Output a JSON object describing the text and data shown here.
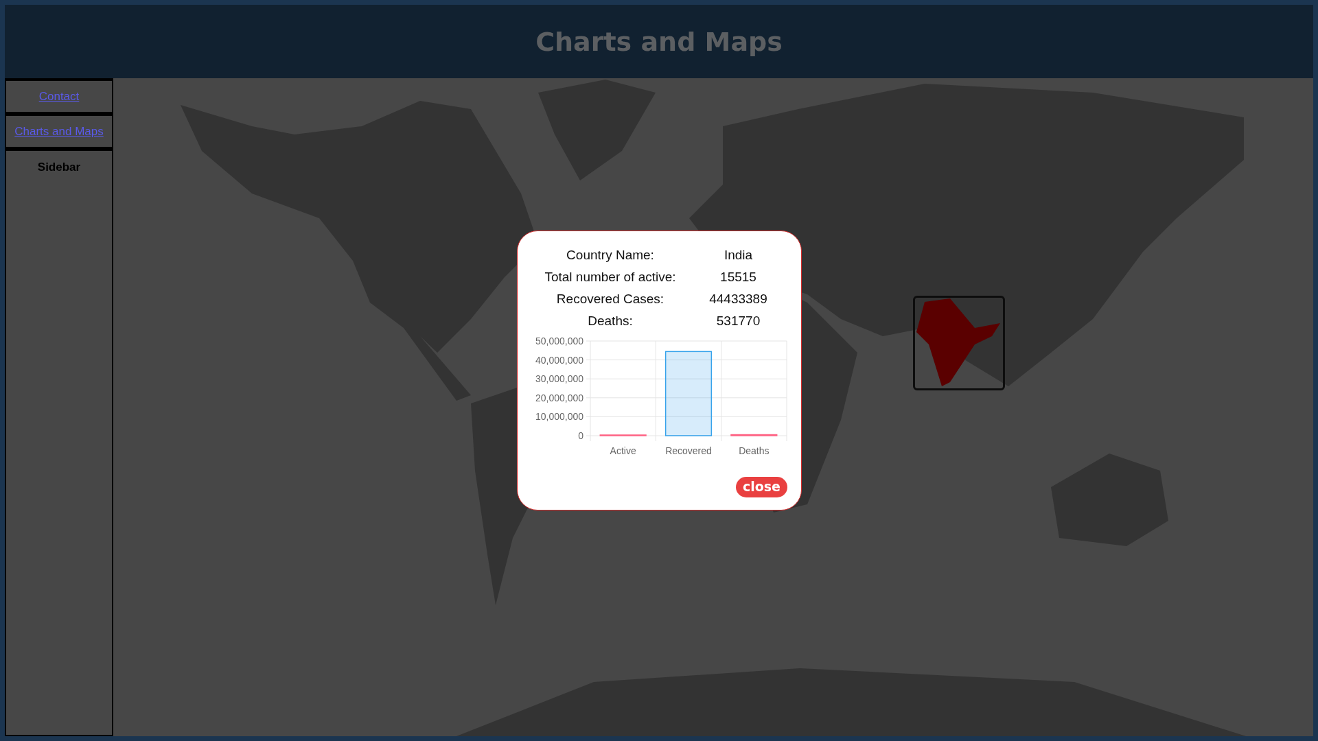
{
  "header": {
    "title": "Charts and Maps"
  },
  "sidebar": {
    "items": [
      {
        "label": "Contact",
        "kind": "link"
      },
      {
        "label": "Charts and Maps",
        "kind": "link"
      },
      {
        "label": "Sidebar",
        "kind": "heading"
      }
    ]
  },
  "popup": {
    "fields": [
      {
        "label": "Country Name:",
        "value": "India"
      },
      {
        "label": "Total number of active:",
        "value": "15515"
      },
      {
        "label": "Recovered Cases:",
        "value": "44433389"
      },
      {
        "label": "Deaths:",
        "value": "531770"
      }
    ],
    "chart_data": {
      "type": "bar",
      "grid": true,
      "categories": [
        "Active",
        "Recovered",
        "Deaths"
      ],
      "values": [
        15515,
        44433389,
        531770
      ],
      "ylim": [
        0,
        50000000
      ],
      "yticks": [
        {
          "value": 0,
          "label": "0"
        },
        {
          "value": 10000000,
          "label": "10,000,000"
        },
        {
          "value": 20000000,
          "label": "20,000,000"
        },
        {
          "value": 30000000,
          "label": "30,000,000"
        },
        {
          "value": 40000000,
          "label": "40,000,000"
        },
        {
          "value": 50000000,
          "label": "50,000,000"
        }
      ]
    },
    "close_button": "close"
  }
}
